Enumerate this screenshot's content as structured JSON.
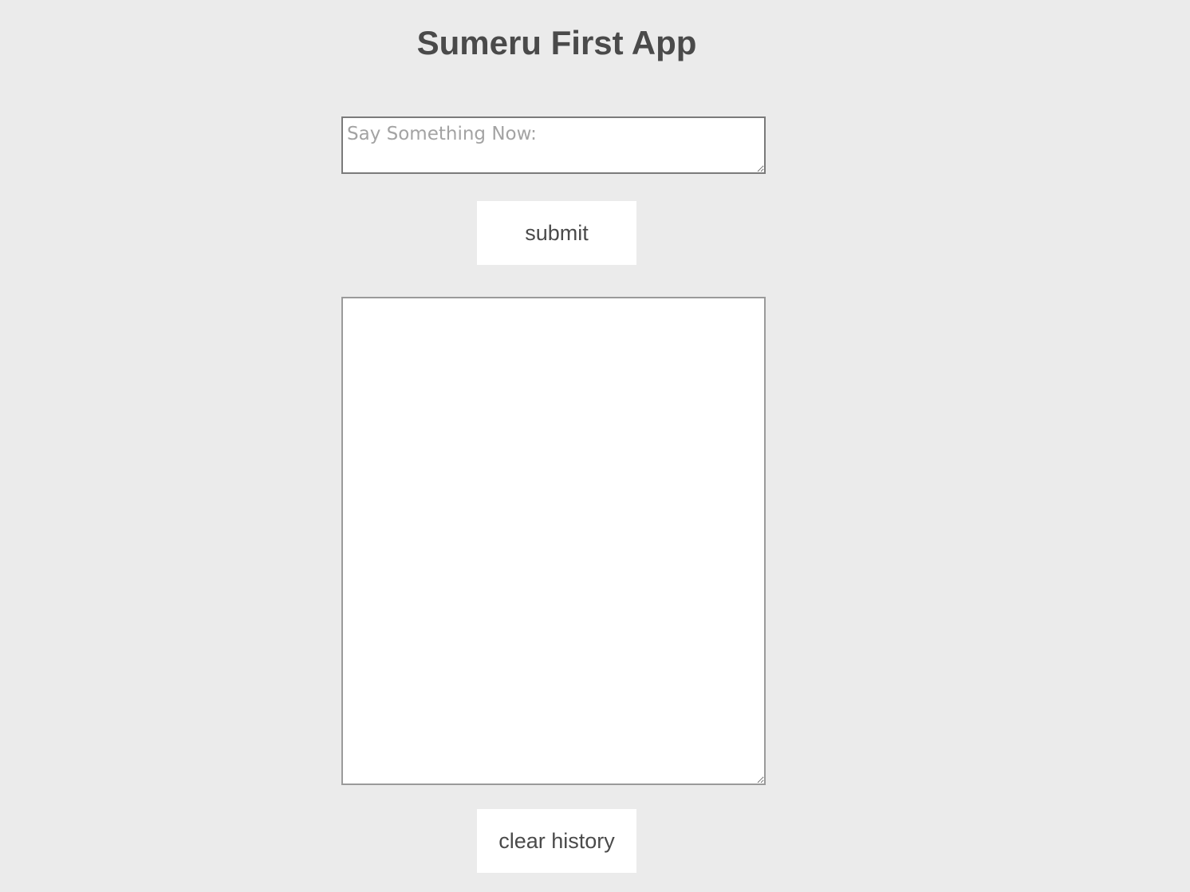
{
  "app": {
    "title": "Sumeru First App"
  },
  "form": {
    "message_placeholder": "Say Something Now:",
    "message_value": "",
    "submit_label": "submit"
  },
  "history": {
    "content": "",
    "clear_label": "clear history"
  },
  "colors": {
    "background": "#ebebeb",
    "text": "#4a4a4a",
    "placeholder": "#a3a3a3",
    "field_border": "#7a7a7a",
    "surface": "#ffffff"
  }
}
